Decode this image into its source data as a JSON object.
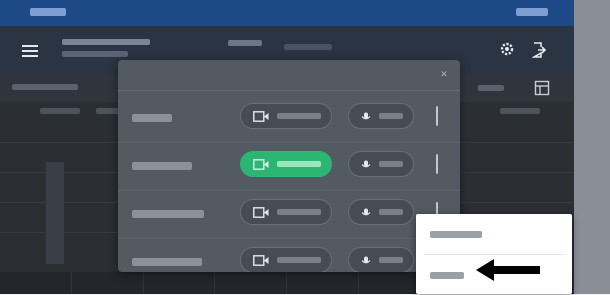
{
  "colors": {
    "statusbar": "#1d4a86",
    "titlebar": "#2a3442",
    "app_background": "#2c2f35",
    "modal_background": "#545a62",
    "primary_button": "#2bb673",
    "bottom_alert_tab": "#7a2a2f",
    "dropdown_background": "#ffffff",
    "pointer_arrow": "#000000"
  },
  "titlebar": {
    "icons": [
      "menu-icon",
      "gear-icon",
      "logout-icon"
    ]
  },
  "modal": {
    "close_icon": "close-icon",
    "rows": [
      {
        "label": "",
        "primary": false,
        "button_a_icon": "video-icon",
        "button_b_icon": "mic-icon"
      },
      {
        "label": "",
        "primary": true,
        "button_a_icon": "video-icon",
        "button_b_icon": "mic-icon"
      },
      {
        "label": "",
        "primary": false,
        "button_a_icon": "video-icon",
        "button_b_icon": "mic-icon"
      },
      {
        "label": "",
        "primary": false,
        "button_a_icon": "video-icon",
        "button_b_icon": "mic-icon"
      }
    ]
  },
  "dropdown": {
    "items": [
      {
        "label": ""
      },
      {
        "label": ""
      }
    ],
    "pointer": "arrow-icon"
  }
}
